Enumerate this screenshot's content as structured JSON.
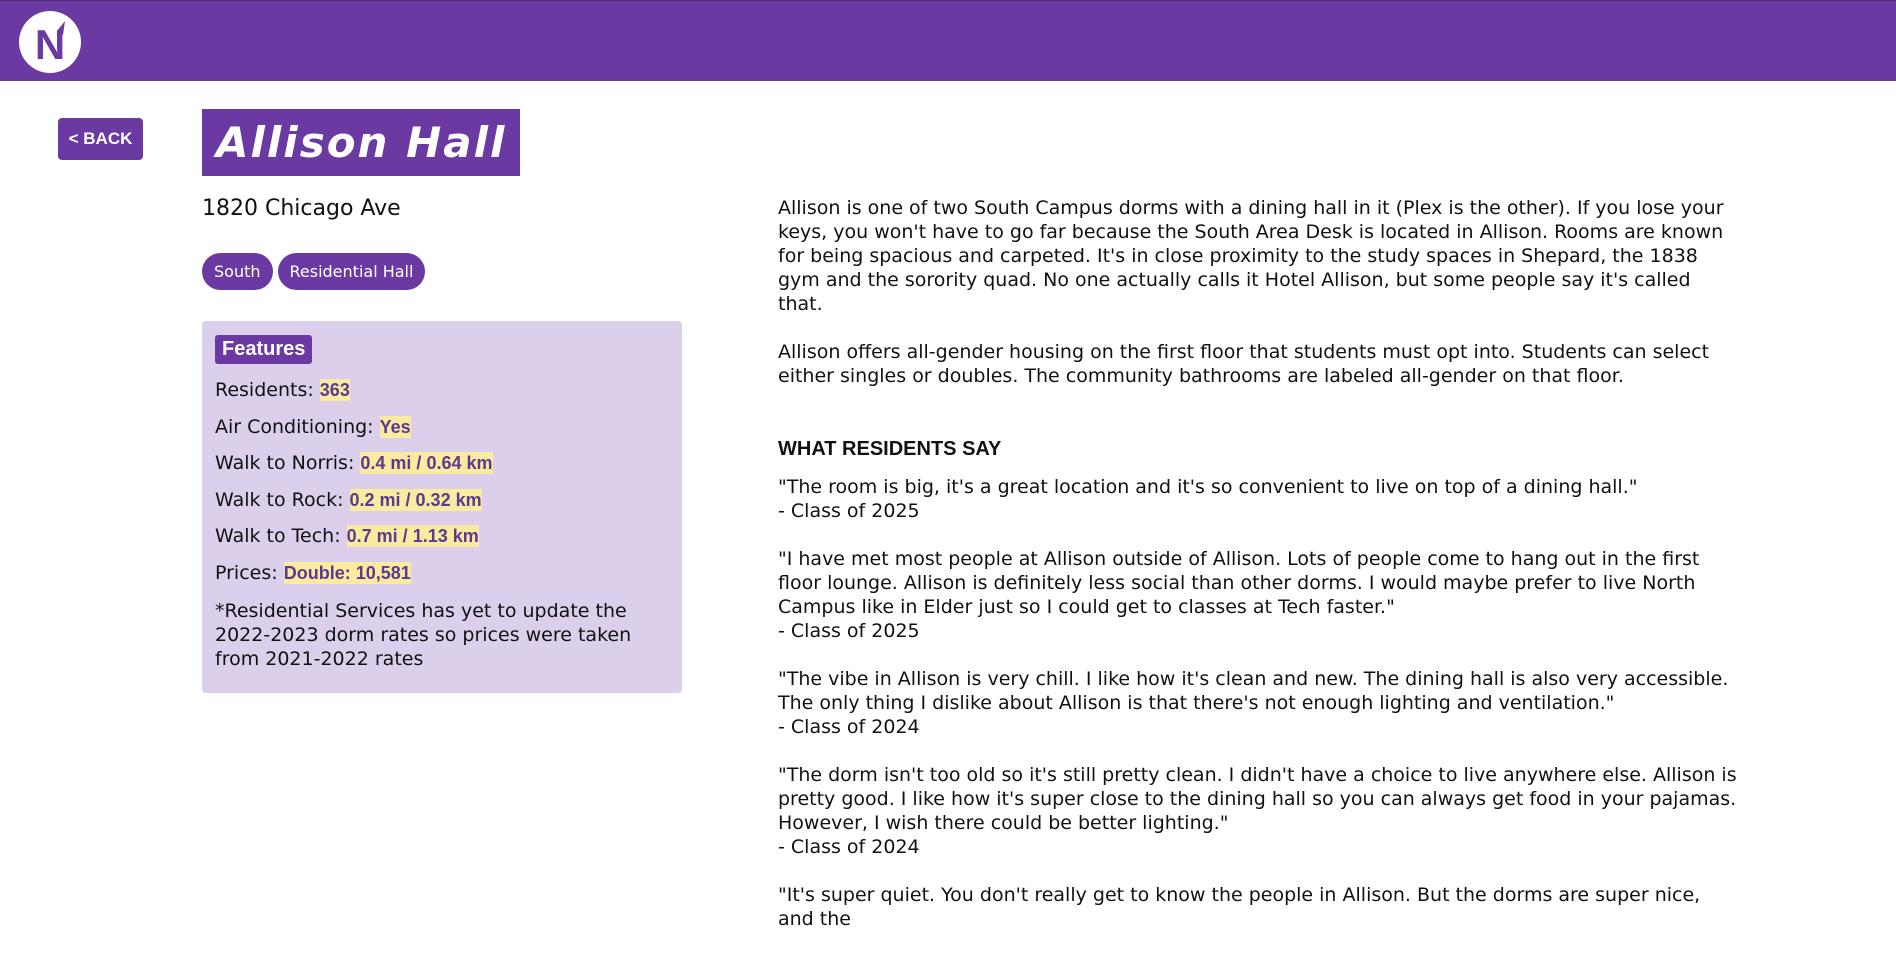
{
  "header": {
    "logo_icon": "northwestern-n-logo-icon",
    "brand_color": "#6a3aa2"
  },
  "back_button": {
    "label": "< BACK"
  },
  "dorm": {
    "name": "Allison Hall",
    "address": "1820 Chicago Ave",
    "tags": [
      "South",
      "Residential Hall"
    ]
  },
  "features": {
    "title": "Features",
    "rows": [
      {
        "label": "Residents: ",
        "value": "363"
      },
      {
        "label": "Air Conditioning: ",
        "value": "Yes"
      },
      {
        "label": "Walk to Norris: ",
        "value": "0.4 mi / 0.64 km"
      },
      {
        "label": "Walk to Rock: ",
        "value": "0.2 mi / 0.32 km"
      },
      {
        "label": "Walk to Tech: ",
        "value": "0.7 mi / 1.13 km"
      },
      {
        "label": "Prices: ",
        "value": "Double: 10,581"
      }
    ],
    "note": "*Residential Services has yet to update the 2022-2023 dorm rates so prices were taken from 2021-2022 rates"
  },
  "description": [
    "Allison is one of two South Campus dorms with a dining hall in it (Plex is the other). If you lose your keys, you won't have to go far because the South Area Desk is located in Allison. Rooms are known for being spacious and carpeted. It's in close proximity to the study spaces in Shepard, the 1838 gym and the sorority quad. No one actually calls it Hotel Allison, but some people say it's called that.",
    "Allison offers all-gender housing on the first floor that students must opt into. Students can select either singles or doubles. The community bathrooms are labeled all-gender on that floor."
  ],
  "reviews": {
    "heading": "WHAT RESIDENTS SAY",
    "items": [
      {
        "text": "\"The room is big, it's a great location and it's so convenient to live on top of a dining hall.\"",
        "author": "- Class of 2025"
      },
      {
        "text": "\"I have met most people at Allison outside of Allison. Lots of people come to hang out in the first floor lounge. Allison is definitely less social than other dorms. I would maybe prefer to live North Campus like in Elder just so I could get to classes at Tech faster.\"",
        "author": "- Class of 2025"
      },
      {
        "text": "\"The vibe in Allison is very chill. I like how it's clean and new. The dining hall is also very accessible. The only thing I dislike about Allison is that there's not enough lighting and ventilation.\"",
        "author": "- Class of 2024"
      },
      {
        "text": "\"The dorm isn't too old so it's still pretty clean. I didn't have a choice to live anywhere else. Allison is pretty good. I like how it's super close to the dining hall so you can always get food in your pajamas. However, I wish there could be better lighting.\"",
        "author": "- Class of 2024"
      },
      {
        "text": "\"It's super quiet. You don't really get to know the people in Allison. But the dorms are super nice, and the",
        "author": ""
      }
    ]
  }
}
